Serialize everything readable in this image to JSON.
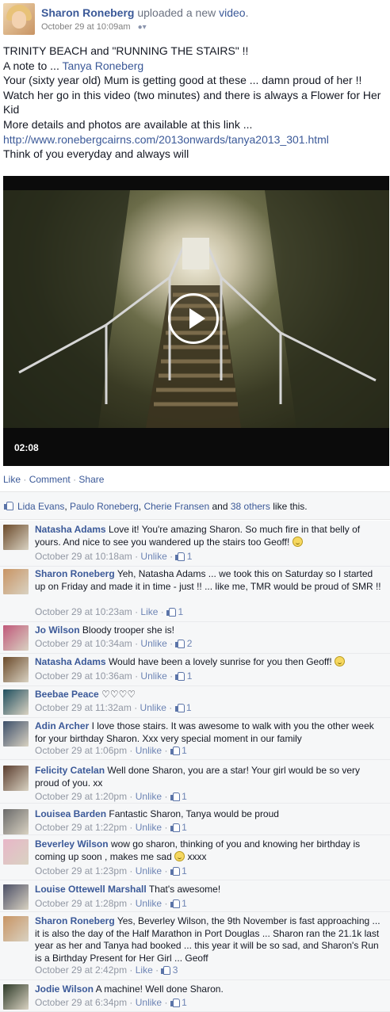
{
  "post": {
    "author": "Sharon Roneberg",
    "action_prefix": " uploaded a new ",
    "action_link": "video",
    "action_suffix": ".",
    "timestamp": "October 29 at 10:09am",
    "audience_icon": "friends-audience-icon",
    "lines": [
      "TRINITY BEACH and \"RUNNING THE STAIRS\" !!",
      "A note to ... ",
      "Your (sixty year old) Mum is getting good at these ... damn proud of her !!",
      "Watch her go in this video (two minutes) and there is always a Flower for Her Kid",
      "More details and photos are available at this link ...",
      "http://www.ronebergcairns.com/2013onwards/tanya2013_301.html",
      "Think of you everyday and always will"
    ],
    "mention": "Tanya Roneberg"
  },
  "video": {
    "duration": "02:08",
    "play_icon": "play-icon"
  },
  "actions": {
    "like": "Like",
    "comment": "Comment",
    "share": "Share"
  },
  "likes": {
    "names": [
      "Lida Evans",
      "Paulo Roneberg",
      "Cherie Fransen"
    ],
    "and": " and ",
    "others": "38 others",
    "suffix": " like this."
  },
  "comments": [
    {
      "name": "Natasha Adams",
      "text": "Love it! You're amazing Sharon. So much fire in that belly of yours. And nice to see you wandered up the stairs too Geoff!",
      "time": "October 29 at 10:18am",
      "action": "Unlike",
      "likes": "1",
      "color": "#6b4a2a"
    },
    {
      "name": "Sharon Roneberg",
      "text": "Yeh, Natasha Adams ... we took this on Saturday so I started up on Friday and made it in time - just !! ... like me, TMR would be proud of SMR !!",
      "time": "October 29 at 10:23am",
      "action": "Like",
      "likes": "1",
      "color": "#c89464"
    },
    {
      "name": "Jo Wilson",
      "text": "Bloody trooper she is!",
      "time": "October 29 at 10:34am",
      "action": "Unlike",
      "likes": "2",
      "color": "#c0587a"
    },
    {
      "name": "Natasha Adams",
      "text": "Would have been a lovely sunrise for you then Geoff!",
      "time": "October 29 at 10:36am",
      "action": "Unlike",
      "likes": "1",
      "color": "#6b4a2a"
    },
    {
      "name": "Beebae Peace",
      "text": "♡♡♡♡",
      "time": "October 29 at 11:32am",
      "action": "Unlike",
      "likes": "1",
      "color": "#1f4f5f"
    },
    {
      "name": "Adin Archer",
      "text": "I love those stairs. It was awesome to walk with you the other week for your birthday Sharon. Xxx very special moment in our family",
      "time": "October 29 at 1:06pm",
      "action": "Unlike",
      "likes": "1",
      "color": "#3c4f6a"
    },
    {
      "name": "Felicity Catelan",
      "text": "Well done Sharon, you are a star! Your girl would be so very proud of you. xx",
      "time": "October 29 at 1:20pm",
      "action": "Unlike",
      "likes": "1",
      "color": "#5a3d2e"
    },
    {
      "name": "Louisea Barden",
      "text": "Fantastic Sharon, Tanya would be proud",
      "time": "October 29 at 1:22pm",
      "action": "Unlike",
      "likes": "1",
      "color": "#6a6a6a"
    },
    {
      "name": "Beverley Wilson",
      "text": "wow go sharon, thinking of you and knowing her birthday is coming up soon , makes me sad",
      "text_after": " xxxx",
      "time": "October 29 at 1:23pm",
      "action": "Unlike",
      "likes": "1",
      "color": "#e8b6c8"
    },
    {
      "name": "Louise Ottewell Marshall",
      "text": "That's awesome!",
      "time": "October 29 at 1:28pm",
      "action": "Unlike",
      "likes": "1",
      "color": "#4b4f66"
    },
    {
      "name": "Sharon Roneberg",
      "text": "Yes, Beverley Wilson, the 9th November is fast approaching ... it is also the day of the Half Marathon in Port Douglas ... Sharon ran the 21.1k last year as her and Tanya had booked ... this year it will be so sad, and Sharon's Run is a Birthday Present for Her Girl ... Geoff",
      "time": "October 29 at 2:42pm",
      "action": "Like",
      "likes": "3",
      "color": "#c89464"
    },
    {
      "name": "Jodie Wilson",
      "text": "A machine! Well done Sharon.",
      "time": "October 29 at 6:34pm",
      "action": "Unlike",
      "likes": "1",
      "color": "#2d3a28"
    }
  ]
}
